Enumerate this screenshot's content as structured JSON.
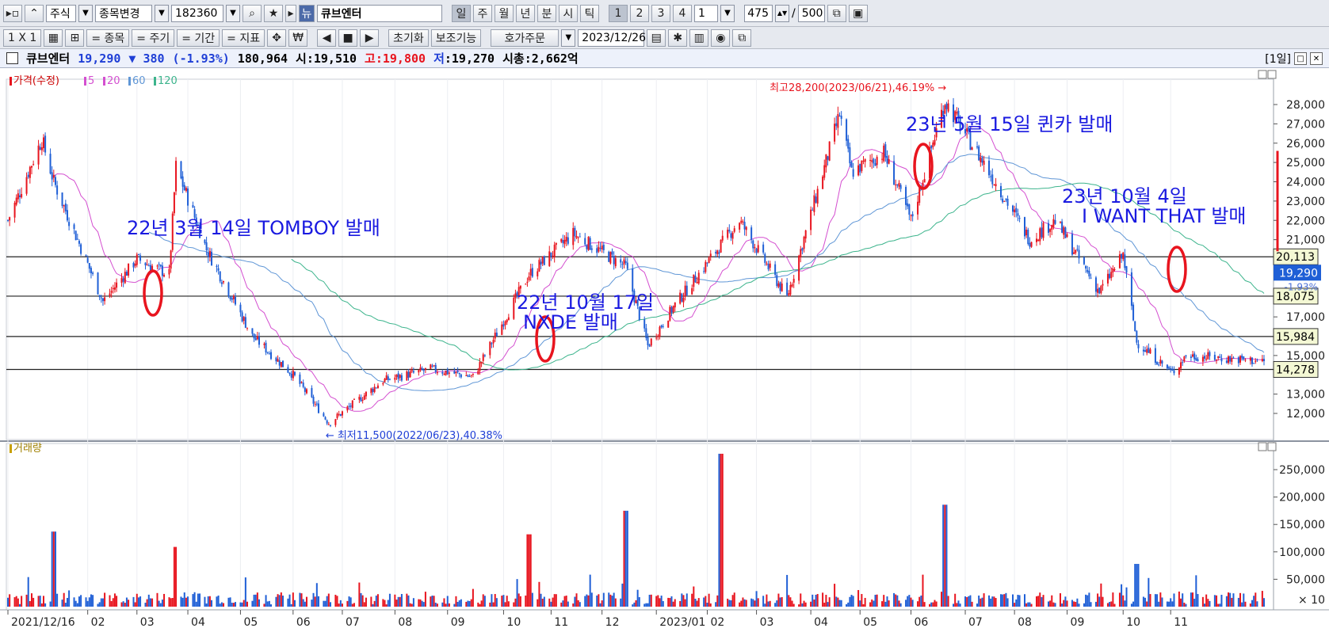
{
  "toolbar1": {
    "stock_type": "주식",
    "change_stock": "종목변경",
    "code": "182360",
    "name": "큐브엔터",
    "periods": [
      "일",
      "주",
      "월",
      "년",
      "분",
      "시",
      "틱"
    ],
    "nums": [
      "1",
      "2",
      "3",
      "4"
    ],
    "count_input": "1",
    "page_value": "475",
    "page_sep": "/",
    "page_total": "500"
  },
  "toolbar2": {
    "layout": "1 X 1",
    "items": [
      "= 종목",
      "= 주기",
      "= 기간",
      "= 지표"
    ],
    "reset": "초기화",
    "aux": "보조기능",
    "order": "호가주문",
    "date": "2023/12/26"
  },
  "infobar": {
    "name": "큐브엔터",
    "price": "19,290",
    "change": "▼ 380",
    "change_pct": "(-1.93%)",
    "volume": "180,964",
    "open": "시:19,510",
    "high_label": "고",
    "high_value": ":19,800",
    "low_label": "저",
    "low_value": ":19,270",
    "mcap": "시총:2,662억",
    "period": "[1일]"
  },
  "colors": {
    "up": "#e8141e",
    "down": "#1f5fd6",
    "ma5": "#d44fd0",
    "ma20": "#d44fd0",
    "ma60": "#5f96d6",
    "ma120": "#3cb48c",
    "annotation": "#1a1ae0",
    "circle": "#e8141e"
  },
  "chart_data": [
    {
      "type": "line",
      "legend": [
        "가격(수정)",
        "5",
        "20",
        "60",
        "120"
      ],
      "ylim": [
        11200,
        28900
      ],
      "yticks": [
        "28,000",
        "27,000",
        "26,000",
        "25,000",
        "24,000",
        "23,000",
        "22,000",
        "21,000",
        "17,000",
        "15,000",
        "13,000",
        "12,000"
      ],
      "xlabels": [
        "2021/12/16",
        "02",
        "03",
        "04",
        "05",
        "06",
        "07",
        "08",
        "09",
        "10",
        "11",
        "12",
        "2023/01",
        "02",
        "03",
        "04",
        "05",
        "06",
        "07",
        "08",
        "09",
        "10",
        "11"
      ],
      "x_range": [
        "2021/12/16",
        "2023/12/26"
      ],
      "price_path": {
        "dates": [
          "2021/12/16",
          "2022/01/05",
          "2022/01/12",
          "2022/02/10",
          "2022/03/02",
          "2022/03/21",
          "2022/03/25",
          "2022/04/12",
          "2022/05/09",
          "2022/06/02",
          "2022/06/23",
          "2022/07/25",
          "2022/08/22",
          "2022/09/16",
          "2022/10/19",
          "2022/11/14",
          "2022/12/15",
          "2022/12/28",
          "2023/01/12",
          "2023/02/20",
          "2023/03/20",
          "2023/04/20",
          "2023/04/27",
          "2023/05/16",
          "2023/06/01",
          "2023/06/21",
          "2023/07/15",
          "2023/08/10",
          "2023/08/25",
          "2023/09/20",
          "2023/10/04",
          "2023/10/12",
          "2023/11/02",
          "2023/11/10",
          "2023/12/26"
        ],
        "close": [
          22000,
          26200,
          24000,
          17800,
          20000,
          19200,
          24800,
          20500,
          16000,
          14000,
          11500,
          13700,
          14300,
          13900,
          19200,
          21300,
          19600,
          15500,
          17500,
          22000,
          18000,
          27500,
          24500,
          25500,
          22000,
          28200,
          24800,
          21000,
          22000,
          18300,
          20200,
          15700,
          14100,
          15000,
          14700
        ]
      },
      "horizontal_lines": [
        {
          "value": 20113,
          "label": "20,113"
        },
        {
          "value": 18075,
          "label": "18,075"
        },
        {
          "value": 15984,
          "label": "15,984"
        },
        {
          "value": 14278,
          "label": "14,278"
        }
      ],
      "current_price": {
        "value": 19290,
        "label": "19,290",
        "change_label": "-1.93%"
      },
      "high": {
        "date": "2023/06/21",
        "value": 28200,
        "label": "최고28,200(2023/06/21),46.19%"
      },
      "low": {
        "date": "2022/06/23",
        "value": 11500,
        "label": "최저11,500(2022/06/23),40.38%"
      },
      "annotations": [
        {
          "date": "2022/03/14",
          "lines": [
            "22년 3월 14일 TOMBOY 발매"
          ]
        },
        {
          "date": "2022/10/17",
          "lines": [
            "22년 10월 17일",
            "NXDE 발매"
          ]
        },
        {
          "date": "2023/05/15",
          "lines": [
            "23년 5월 15일 퀸카 발매"
          ]
        },
        {
          "date": "2023/10/04",
          "lines": [
            "23년 10월 4일",
            "I WANT THAT 발매"
          ]
        }
      ]
    },
    {
      "type": "bar",
      "legend": [
        "거래량"
      ],
      "ylim": [
        0,
        300000
      ],
      "yticks": [
        "250,000",
        "200,000",
        "150,000",
        "100,000",
        "50,000"
      ],
      "unit": "× 10",
      "notable": [
        {
          "date": "2022/01/12",
          "value": 137000
        },
        {
          "date": "2022/03/25",
          "value": 109000
        },
        {
          "date": "2022/10/19",
          "value": 132000
        },
        {
          "date": "2022/12/15",
          "value": 175000
        },
        {
          "date": "2023/02/09",
          "value": 279000
        },
        {
          "date": "2023/06/21",
          "value": 186000
        },
        {
          "date": "2023/10/12",
          "value": 78000
        }
      ]
    }
  ]
}
